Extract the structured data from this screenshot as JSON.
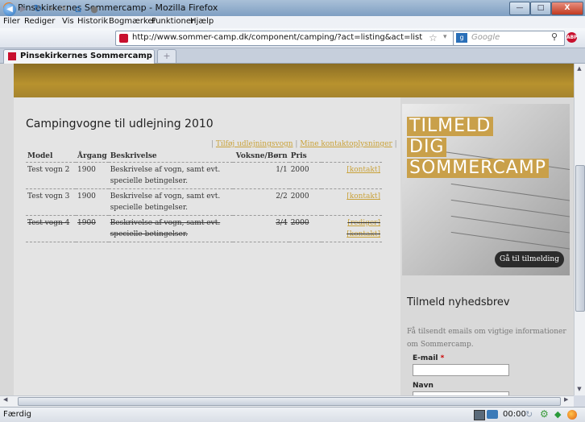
{
  "window": {
    "title": "Pinsekirkernes Sommercamp - Mozilla Firefox"
  },
  "menu": [
    "Filer",
    "Rediger",
    "Vis",
    "Historik",
    "Bogmærker",
    "Funktioner",
    "Hjælp"
  ],
  "navbar": {
    "url": "http://www.sommer-camp.dk/component/camping/?act=listing&act=list",
    "search_placeholder": "Google"
  },
  "tab": {
    "label": "Pinsekirkernes Sommercamp"
  },
  "page": {
    "title": "Campingvogne til udlejning 2010",
    "actions": {
      "sep": "|",
      "add": "Tilføj udlejningsvogn",
      "contact": "Mine kontaktoplysninger"
    },
    "columns": [
      "Model",
      "Årgang",
      "Beskrivelse",
      "Voksne/Børn",
      "Pris"
    ],
    "rows": [
      {
        "model": "Test vogn 2",
        "year": "1900",
        "desc": "Beskrivelse af vogn, samt evt. specielle betingelser.",
        "ab": "1/1",
        "price": "2000",
        "edit": "",
        "contact": "[kontakt]",
        "strike": false
      },
      {
        "model": "Test vogn 3",
        "year": "1900",
        "desc": "Beskrivelse af vogn, samt evt. specielle betingelser.",
        "ab": "2/2",
        "price": "2000",
        "edit": "",
        "contact": "[kontakt]",
        "strike": false
      },
      {
        "model": "Test vogn 4",
        "year": "1900",
        "desc": "Beskrivelse af vogn, samt evt. specielle betingelser.",
        "ab": "3/4",
        "price": "2000",
        "edit": "[rediger]",
        "contact": "[kontakt]",
        "strike": true
      }
    ]
  },
  "sidebar": {
    "signup_lines": [
      "TILMELD",
      "DIG",
      "SOMMERCAMP"
    ],
    "signup_button": "Gå til tilmelding",
    "newsletter": {
      "title": "Tilmeld nyhedsbrev",
      "text": "Få tilsendt emails om vigtige informationer om Sommercamp.",
      "email_label": "E-mail",
      "required_mark": "*",
      "name_label": "Navn"
    }
  },
  "status": {
    "text": "Færdig",
    "clock": "00:00"
  },
  "colors": {
    "accent": "#c9a23a",
    "banner": "#a5842e"
  }
}
